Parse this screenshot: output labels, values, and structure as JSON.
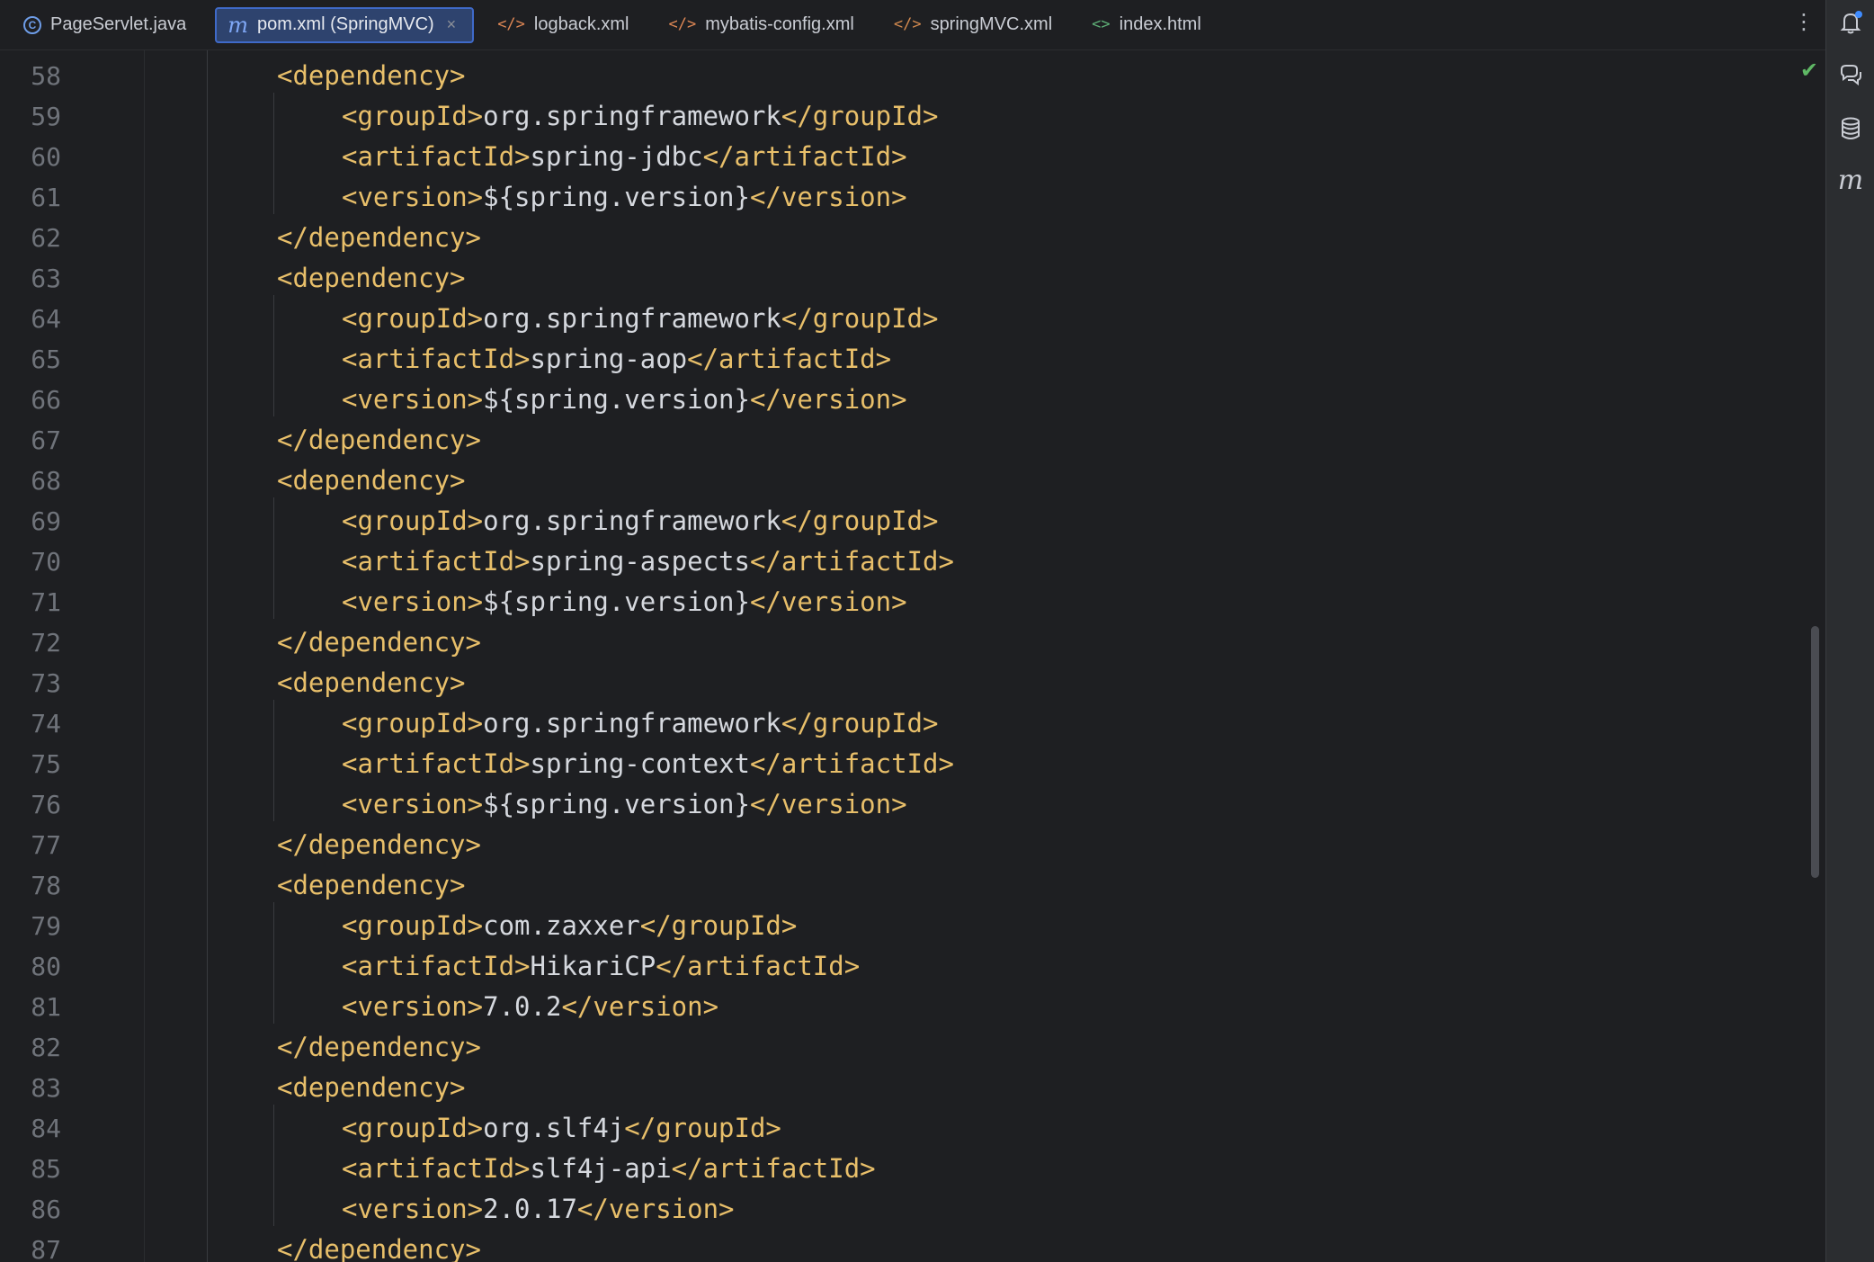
{
  "tabs": [
    {
      "label": "PageServlet.java",
      "icon": "java-class-icon",
      "active": false
    },
    {
      "label": "pom.xml (SpringMVC)",
      "icon": "maven-icon",
      "active": true
    },
    {
      "label": "logback.xml",
      "icon": "xml-icon",
      "active": false
    },
    {
      "label": "mybatis-config.xml",
      "icon": "xml-icon",
      "active": false
    },
    {
      "label": "springMVC.xml",
      "icon": "spring-xml-icon",
      "active": false
    },
    {
      "label": "index.html",
      "icon": "html-icon",
      "active": false
    }
  ],
  "tab_close_glyph": "×",
  "tab_more_glyph": "⋮",
  "check_glyph": "✔",
  "icon_glyphs": {
    "java": "C",
    "maven": "m",
    "xml": "</>",
    "spring": "</>",
    "html": "<>"
  },
  "toolstrip": [
    {
      "name": "notifications-icon"
    },
    {
      "name": "ai-assistant-icon"
    },
    {
      "name": "database-icon"
    },
    {
      "name": "maven-tool-icon",
      "glyph": "m"
    }
  ],
  "colors": {
    "tag": "#e8bf6a",
    "text": "#d5d8de",
    "line_number": "#6f737a",
    "active_tab": "#2e436e"
  },
  "lines": [
    {
      "n": "58",
      "indent": 1,
      "open": "<dependency>",
      "text": "",
      "close": ""
    },
    {
      "n": "59",
      "indent": 2,
      "open": "<groupId>",
      "text": "org.springframework",
      "close": "</groupId>"
    },
    {
      "n": "60",
      "indent": 2,
      "open": "<artifactId>",
      "text": "spring-jdbc",
      "close": "</artifactId>"
    },
    {
      "n": "61",
      "indent": 2,
      "open": "<version>",
      "text": "${spring.version}",
      "close": "</version>"
    },
    {
      "n": "62",
      "indent": 1,
      "open": "</dependency>",
      "text": "",
      "close": ""
    },
    {
      "n": "63",
      "indent": 1,
      "open": "<dependency>",
      "text": "",
      "close": ""
    },
    {
      "n": "64",
      "indent": 2,
      "open": "<groupId>",
      "text": "org.springframework",
      "close": "</groupId>"
    },
    {
      "n": "65",
      "indent": 2,
      "open": "<artifactId>",
      "text": "spring-aop",
      "close": "</artifactId>"
    },
    {
      "n": "66",
      "indent": 2,
      "open": "<version>",
      "text": "${spring.version}",
      "close": "</version>"
    },
    {
      "n": "67",
      "indent": 1,
      "open": "</dependency>",
      "text": "",
      "close": ""
    },
    {
      "n": "68",
      "indent": 1,
      "open": "<dependency>",
      "text": "",
      "close": ""
    },
    {
      "n": "69",
      "indent": 2,
      "open": "<groupId>",
      "text": "org.springframework",
      "close": "</groupId>"
    },
    {
      "n": "70",
      "indent": 2,
      "open": "<artifactId>",
      "text": "spring-aspects",
      "close": "</artifactId>"
    },
    {
      "n": "71",
      "indent": 2,
      "open": "<version>",
      "text": "${spring.version}",
      "close": "</version>"
    },
    {
      "n": "72",
      "indent": 1,
      "open": "</dependency>",
      "text": "",
      "close": ""
    },
    {
      "n": "73",
      "indent": 1,
      "open": "<dependency>",
      "text": "",
      "close": ""
    },
    {
      "n": "74",
      "indent": 2,
      "open": "<groupId>",
      "text": "org.springframework",
      "close": "</groupId>"
    },
    {
      "n": "75",
      "indent": 2,
      "open": "<artifactId>",
      "text": "spring-context",
      "close": "</artifactId>"
    },
    {
      "n": "76",
      "indent": 2,
      "open": "<version>",
      "text": "${spring.version}",
      "close": "</version>"
    },
    {
      "n": "77",
      "indent": 1,
      "open": "</dependency>",
      "text": "",
      "close": ""
    },
    {
      "n": "78",
      "indent": 1,
      "open": "<dependency>",
      "text": "",
      "close": ""
    },
    {
      "n": "79",
      "indent": 2,
      "open": "<groupId>",
      "text": "com.zaxxer",
      "close": "</groupId>"
    },
    {
      "n": "80",
      "indent": 2,
      "open": "<artifactId>",
      "text": "HikariCP",
      "close": "</artifactId>"
    },
    {
      "n": "81",
      "indent": 2,
      "open": "<version>",
      "text": "7.0.2",
      "close": "</version>"
    },
    {
      "n": "82",
      "indent": 1,
      "open": "</dependency>",
      "text": "",
      "close": ""
    },
    {
      "n": "83",
      "indent": 1,
      "open": "<dependency>",
      "text": "",
      "close": ""
    },
    {
      "n": "84",
      "indent": 2,
      "open": "<groupId>",
      "text": "org.slf4j",
      "close": "</groupId>"
    },
    {
      "n": "85",
      "indent": 2,
      "open": "<artifactId>",
      "text": "slf4j-api",
      "close": "</artifactId>"
    },
    {
      "n": "86",
      "indent": 2,
      "open": "<version>",
      "text": "2.0.17",
      "close": "</version>"
    },
    {
      "n": "87",
      "indent": 1,
      "open": "</dependency>",
      "text": "",
      "close": ""
    }
  ]
}
